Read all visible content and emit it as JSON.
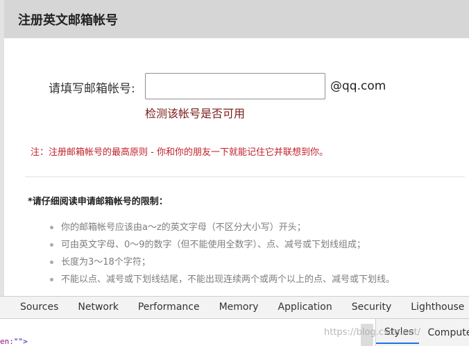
{
  "card": {
    "title": "注册英文邮箱帐号",
    "form": {
      "label": "请填写邮箱帐号:",
      "input_value": "",
      "input_placeholder": "",
      "domain": "@qq.com",
      "check_link": "检测该帐号是否可用"
    },
    "note": "注：注册邮箱帐号的最高原则 - 你和你的朋友一下就能记住它并联想到你。",
    "rules_title": "*请仔细阅读申请邮箱帐号的限制：",
    "rules": [
      "你的邮箱帐号应该由a～z的英文字母（不区分大小写）开头；",
      "可由英文字母、0～9的数字（但不能使用全数字）、点、减号或下划线组成；",
      "长度为3～18个字符；",
      "不能以点、减号或下划线结尾，不能出现连续两个或两个以上的点、减号或下划线。"
    ]
  },
  "devtools": {
    "tabs": [
      "Sources",
      "Network",
      "Performance",
      "Memory",
      "Application",
      "Security",
      "Lighthouse"
    ],
    "side_tabs": [
      "Styles",
      "Compute"
    ],
    "code_prefix": "en:",
    "code_value": "\"\">"
  },
  "watermark": "https://blog.csdn.net/"
}
